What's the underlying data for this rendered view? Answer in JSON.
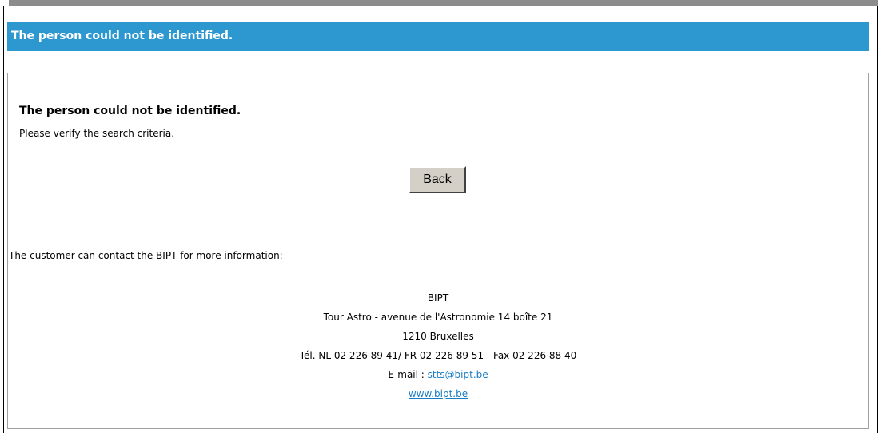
{
  "header": {
    "title": "The person could not be identified."
  },
  "message": {
    "title": "The person could not be identified.",
    "subtitle": "Please verify the search criteria."
  },
  "actions": {
    "back_label": "Back"
  },
  "contact": {
    "intro": "The customer can contact the BIPT for more information:",
    "name": "BIPT",
    "address": "Tour Astro - avenue de l'Astronomie 14 boîte 21",
    "city": "1210 Bruxelles",
    "phone": "Tél. NL 02 226 89 41/ FR 02 226 89 51 - Fax 02 226 88 40",
    "email_label": "E-mail : ",
    "email": "stts@bipt.be",
    "website": "www.bipt.be"
  },
  "colors": {
    "header_bg": "#2d97d0",
    "link": "#1a7dc4",
    "top_bar": "#8c8c8c"
  }
}
